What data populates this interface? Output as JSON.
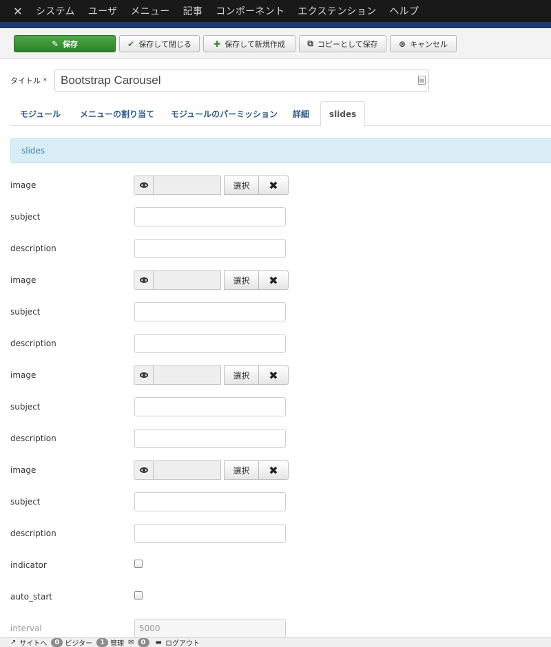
{
  "topnav": {
    "logo_icon": "joomla-logo-icon",
    "menu": [
      "システム",
      "ユーザ",
      "メニュー",
      "記事",
      "コンポーネント",
      "エクステンション",
      "ヘルプ"
    ]
  },
  "toolbar": {
    "save": "保存",
    "save_close": "保存して閉じる",
    "save_new": "保存して新規作成",
    "save_copy": "コピーとして保存",
    "cancel": "キャンセル"
  },
  "title": {
    "label": "タイトル *",
    "value": "Bootstrap Carousel"
  },
  "tabs": [
    "モジュール",
    "メニューの割り当て",
    "モジュールのパーミッション",
    "詳細",
    "slides"
  ],
  "active_tab": "slides",
  "info": "slides",
  "fields": {
    "image_label": "image",
    "subject_label": "subject",
    "description_label": "description",
    "select_label": "選択",
    "clear_symbol": "✖",
    "indicator_label": "indicator",
    "auto_start_label": "auto_start",
    "interval_label": "interval",
    "interval_value": "5000"
  },
  "statusbar": {
    "site_label": "サイトへ",
    "visitors_count": "0",
    "visitors_label": "ビジター",
    "admins_count": "1",
    "admins_label": "管理",
    "messages_count": "0",
    "logout_label": "ログアウト"
  }
}
